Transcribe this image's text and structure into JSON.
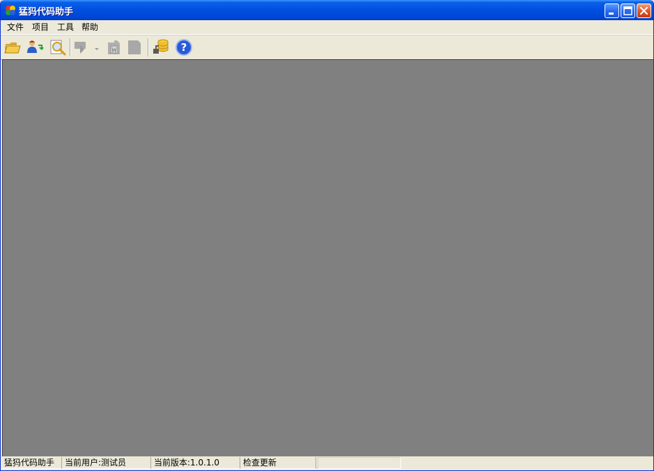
{
  "window": {
    "title": "猛犸代码助手"
  },
  "menu": {
    "items": [
      {
        "label": "文件"
      },
      {
        "label": "项目"
      },
      {
        "label": "工具"
      },
      {
        "label": "帮助"
      }
    ]
  },
  "toolbar": {
    "icons": [
      "open-folder-icon",
      "switch-user-icon",
      "search-icon",
      "generate-icon",
      "dropdown-arrow-icon",
      "delete-icon",
      "document-icon",
      "database-icon",
      "help-icon"
    ]
  },
  "statusbar": {
    "app_name": "猛犸代码助手",
    "current_user": "当前用户:测试员",
    "current_version": "当前版本:1.0.1.0",
    "check_update": "检查更新"
  },
  "colors": {
    "titlebar": "#0050e0",
    "chrome": "#ece9d8",
    "mdi_background": "#808080",
    "close_button": "#e0582c"
  }
}
